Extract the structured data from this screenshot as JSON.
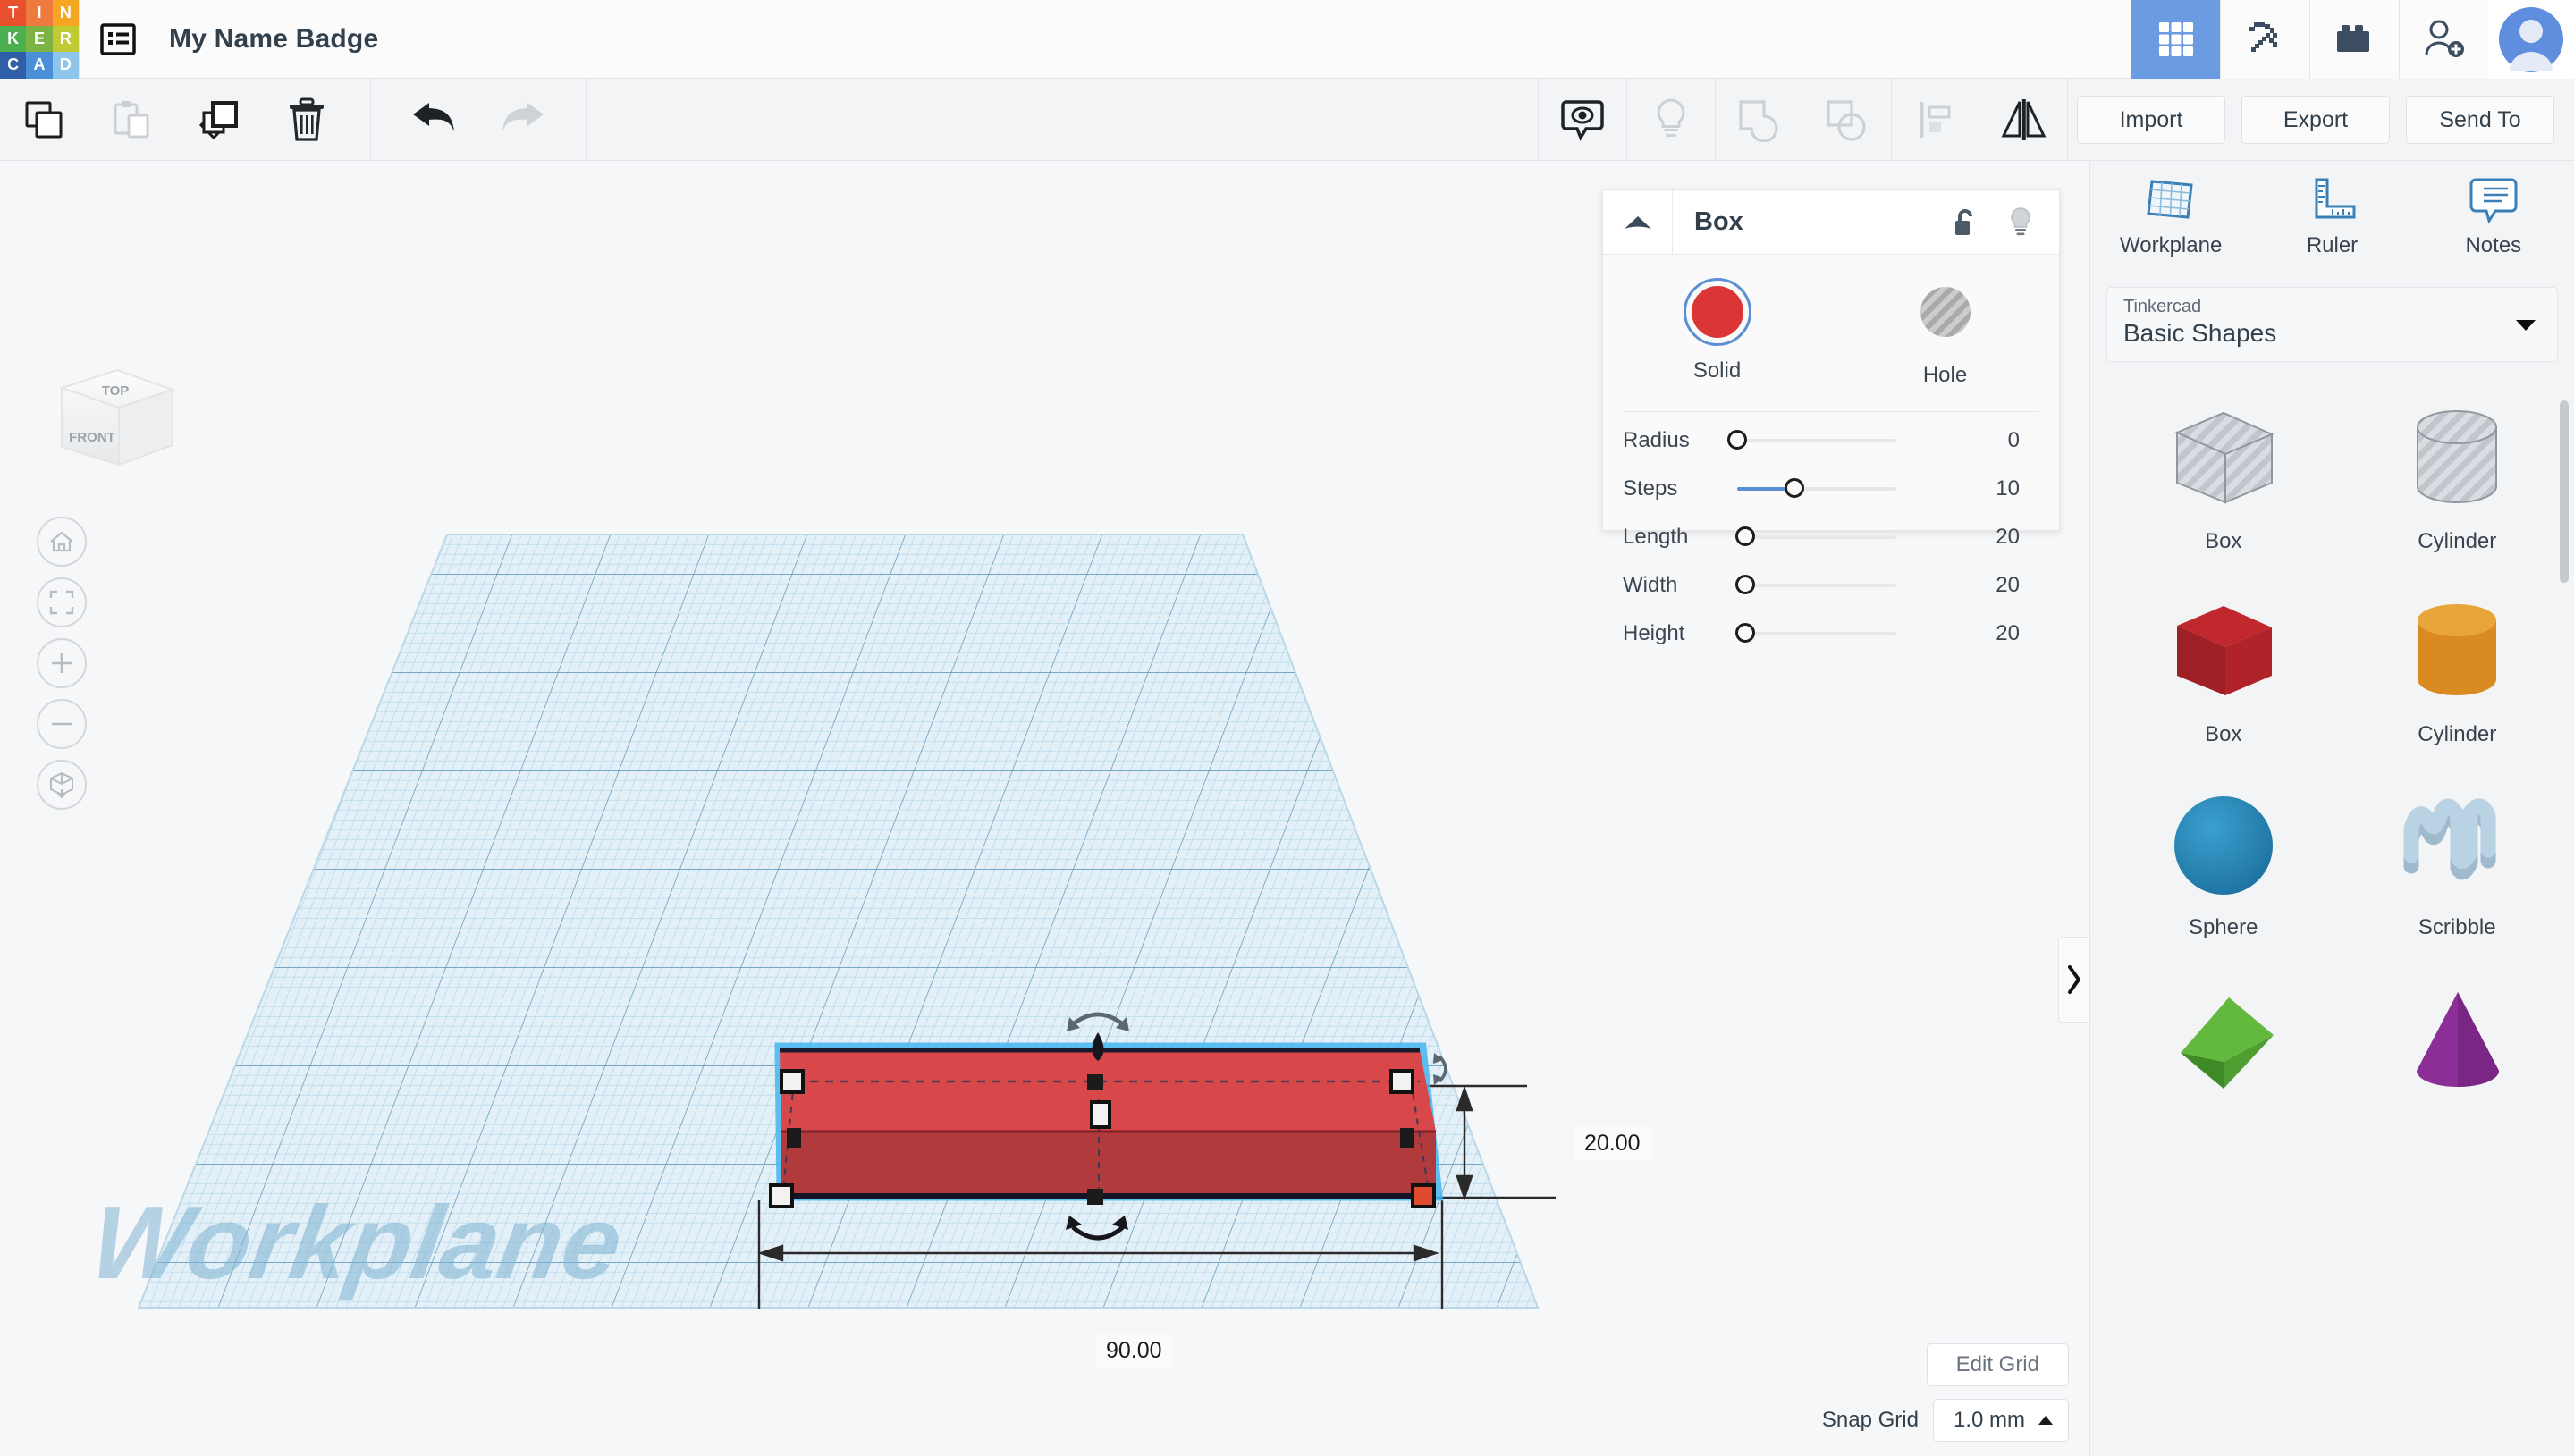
{
  "app": {
    "logo_letters": [
      "T",
      "I",
      "N",
      "K",
      "E",
      "R",
      "C",
      "A",
      "D"
    ],
    "logo_colors": [
      "#e8502e",
      "#ef7a3e",
      "#f5a623",
      "#4caf50",
      "#7cb342",
      "#c0ca33",
      "#2f5fa8",
      "#4a90d9",
      "#8ec5ea"
    ],
    "menu_icon": "list-menu-icon",
    "document_title": "My Name Badge"
  },
  "topbar_right": [
    {
      "name": "grid-apps-icon",
      "label": "Apps",
      "active": true
    },
    {
      "name": "pickaxe-minecraft-icon",
      "label": "Minecraft",
      "active": false
    },
    {
      "name": "lego-brick-icon",
      "label": "Blocks",
      "active": false
    },
    {
      "name": "add-person-icon",
      "label": "Invite",
      "active": false
    },
    {
      "name": "user-avatar-icon",
      "label": "Account",
      "active": false
    }
  ],
  "toolbar": {
    "left_buttons": [
      {
        "name": "copy-button",
        "label": "Copy",
        "icon": "copy-icon",
        "disabled": false
      },
      {
        "name": "paste-button",
        "label": "Paste",
        "icon": "paste-icon",
        "disabled": true
      },
      {
        "name": "duplicate-button",
        "label": "Duplicate",
        "icon": "duplicate-icon",
        "disabled": false
      },
      {
        "name": "delete-button",
        "label": "Delete",
        "icon": "trash-icon",
        "disabled": false
      }
    ],
    "history_buttons": [
      {
        "name": "undo-button",
        "label": "Undo",
        "icon": "undo-arrow-icon",
        "disabled": false
      },
      {
        "name": "redo-button",
        "label": "Redo",
        "icon": "redo-arrow-icon",
        "disabled": true
      }
    ],
    "mid_buttons": [
      {
        "name": "show-hide-button",
        "label": "Show/Hide",
        "icon": "eye-bubble-icon",
        "disabled": false
      },
      {
        "name": "light-button",
        "label": "Light",
        "icon": "lightbulb-icon",
        "disabled": true
      },
      {
        "name": "group-button",
        "label": "Group",
        "icon": "group-shapes-icon",
        "disabled": true
      },
      {
        "name": "ungroup-button",
        "label": "Ungroup",
        "icon": "ungroup-shapes-icon",
        "disabled": true
      },
      {
        "name": "align-button",
        "label": "Align",
        "icon": "align-icon",
        "disabled": true
      },
      {
        "name": "mirror-button",
        "label": "Mirror",
        "icon": "mirror-flip-icon",
        "disabled": false
      }
    ],
    "actions": [
      {
        "name": "import-button",
        "label": "Import"
      },
      {
        "name": "export-button",
        "label": "Export"
      },
      {
        "name": "send-to-button",
        "label": "Send To"
      }
    ]
  },
  "viewport": {
    "viewcube": {
      "top_face": "TOP",
      "front_face": "FRONT"
    },
    "nav_buttons": [
      {
        "name": "home-view-button",
        "icon": "home-icon"
      },
      {
        "name": "fit-to-view-button",
        "icon": "fit-frame-icon"
      },
      {
        "name": "zoom-in-button",
        "icon": "plus-icon"
      },
      {
        "name": "zoom-out-button",
        "icon": "minus-icon"
      },
      {
        "name": "ortho-perspective-toggle",
        "icon": "cube-ortho-icon"
      }
    ],
    "workplane_watermark": "Workplane",
    "dimension_width": "90.00",
    "dimension_depth": "20.00",
    "edit_grid_label": "Edit Grid",
    "snap_grid_label": "Snap Grid",
    "snap_grid_value": "1.0 mm",
    "collapse_tab_icon": "chevron-right-icon"
  },
  "inspector": {
    "title": "Box",
    "collapse_icon": "triangle-up-icon",
    "lock_icon": "unlock-icon",
    "light_icon": "lightbulb-icon",
    "modes": [
      {
        "name": "solid-mode",
        "label": "Solid",
        "color": "#dc3535",
        "selected": true
      },
      {
        "name": "hole-mode",
        "label": "Hole",
        "color": "#b4b4b4",
        "selected": false
      }
    ],
    "sliders": [
      {
        "name": "radius-slider",
        "label": "Radius",
        "value": "0",
        "pct": 0
      },
      {
        "name": "steps-slider",
        "label": "Steps",
        "value": "10",
        "pct": 36
      },
      {
        "name": "length-slider",
        "label": "Length",
        "value": "20",
        "pct": 5
      },
      {
        "name": "width-slider",
        "label": "Width",
        "value": "20",
        "pct": 5
      },
      {
        "name": "height-slider",
        "label": "Height",
        "value": "20",
        "pct": 5
      }
    ]
  },
  "right_panel": {
    "tools": [
      {
        "name": "workplane-tool",
        "label": "Workplane",
        "icon": "workplane-grid-icon"
      },
      {
        "name": "ruler-tool",
        "label": "Ruler",
        "icon": "ruler-icon"
      },
      {
        "name": "notes-tool",
        "label": "Notes",
        "icon": "notes-bubble-icon"
      }
    ],
    "library_source": "Tinkercad",
    "library_name": "Basic Shapes",
    "caret_icon": "caret-down-icon",
    "shapes": [
      {
        "name": "shape-box-hole",
        "label": "Box",
        "art": "box-striped",
        "color": "#c6cbd0"
      },
      {
        "name": "shape-cylinder-hole",
        "label": "Cylinder",
        "art": "cylinder-striped",
        "color": "#c6cbd0"
      },
      {
        "name": "shape-box-solid",
        "label": "Box",
        "art": "box-solid",
        "color": "#c0282d"
      },
      {
        "name": "shape-cylinder-solid",
        "label": "Cylinder",
        "art": "cylinder-solid",
        "color": "#e09226"
      },
      {
        "name": "shape-sphere",
        "label": "Sphere",
        "art": "sphere",
        "color": "#2986b8"
      },
      {
        "name": "shape-scribble",
        "label": "Scribble",
        "art": "scribble",
        "color": "#a8c4d8"
      },
      {
        "name": "shape-pyramid",
        "label": "",
        "art": "pyramid",
        "color": "#5aa635"
      },
      {
        "name": "shape-cone",
        "label": "",
        "art": "cone",
        "color": "#8b2f96"
      }
    ]
  },
  "colors": {
    "accent_blue": "#5b8fd4",
    "active_blue": "#6b9be0",
    "box_top": "#d8484a",
    "box_front": "#b03a3c",
    "selection_outline": "#45b6ef",
    "workplane_fill": "#dceaf3",
    "workplane_grid": "#9ec9e2",
    "text_dark": "#32404c"
  }
}
